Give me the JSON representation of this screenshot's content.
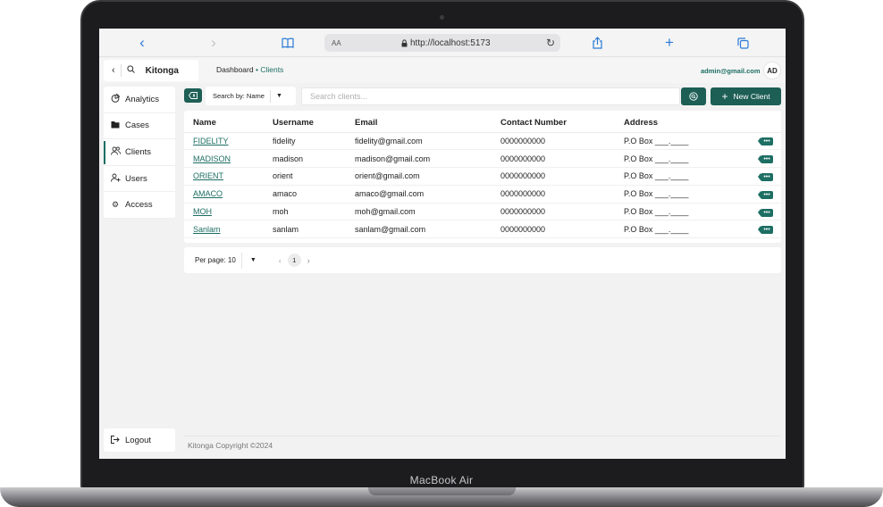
{
  "device": {
    "label": "MacBook Air"
  },
  "browser": {
    "text_size_label": "AA",
    "url": "http://localhost:5173",
    "icons": [
      "back-icon",
      "forward-icon",
      "book-icon",
      "lock-icon",
      "reload-icon",
      "share-icon",
      "plus-icon",
      "tabs-icon"
    ]
  },
  "header": {
    "brand": "Kitonga",
    "breadcrumb_root": "Dashboard",
    "breadcrumb_separator": "•",
    "breadcrumb_current": "Clients",
    "user_email": "admin@gmail.com",
    "avatar_initials": "AD"
  },
  "sidebar": {
    "items": [
      {
        "label": "Analytics",
        "icon": "analytics-icon",
        "active": false
      },
      {
        "label": "Cases",
        "icon": "folder-icon",
        "active": false
      },
      {
        "label": "Clients",
        "icon": "clients-icon",
        "active": true
      },
      {
        "label": "Users",
        "icon": "add-user-icon",
        "active": false
      },
      {
        "label": "Access",
        "icon": "gear-icon",
        "active": false
      }
    ],
    "logout_label": "Logout"
  },
  "toolbar": {
    "search_by_label": "Search by: Name",
    "search_placeholder": "Search clients...",
    "search_value": "",
    "new_client_label": "New Client"
  },
  "table": {
    "columns": [
      "Name",
      "Username",
      "Email",
      "Contact Number",
      "Address"
    ],
    "rows": [
      {
        "name": "FIDELITY",
        "username": "fidelity",
        "email": "fidelity@gmail.com",
        "phone": "0000000000",
        "address": "P.O Box ___.____"
      },
      {
        "name": "MADISON",
        "username": "madison",
        "email": "madison@gmail.com",
        "phone": "0000000000",
        "address": "P.O Box ___.____"
      },
      {
        "name": "ORIENT",
        "username": "orient",
        "email": "orient@gmail.com",
        "phone": "0000000000",
        "address": "P.O Box ___.____"
      },
      {
        "name": "AMACO",
        "username": "amaco",
        "email": "amaco@gmail.com",
        "phone": "0000000000",
        "address": "P.O Box ___.____"
      },
      {
        "name": "MOH",
        "username": "moh",
        "email": "moh@gmail.com",
        "phone": "0000000000",
        "address": "P.O Box ___.____"
      },
      {
        "name": "Sanlam",
        "username": "sanlam",
        "email": "sanlam@gmail.com",
        "phone": "0000000000",
        "address": "P.O Box ___.____"
      }
    ]
  },
  "pagination": {
    "per_page_label": "Per page: 10",
    "current_page": "1"
  },
  "footer": {
    "copyright": "Kitonga Copyright ©2024"
  },
  "colors": {
    "primary": "#1d5e55",
    "link": "#1d6e63"
  }
}
